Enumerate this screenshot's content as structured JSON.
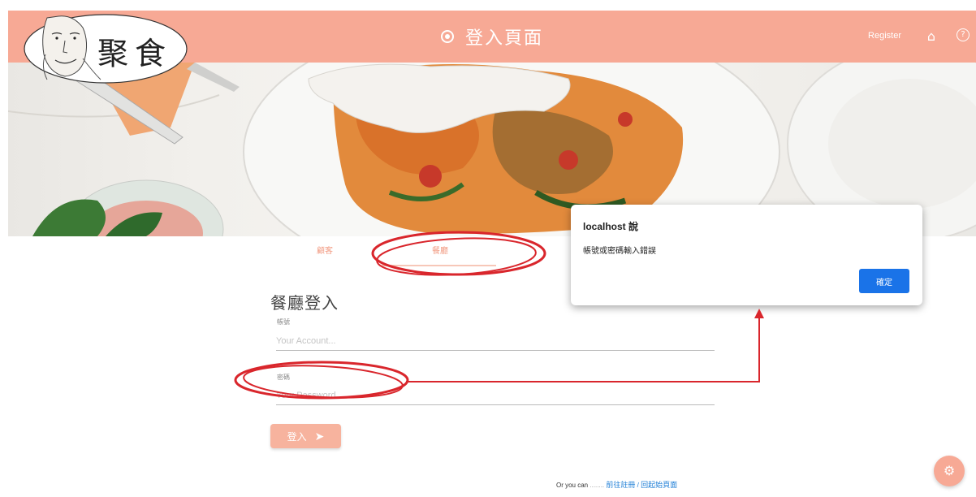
{
  "header": {
    "title": "登入頁面",
    "register_label": "Register",
    "logo_text": "聚食",
    "home_icon": "home-icon",
    "help_icon": "help-icon",
    "background_color": "#f7a995"
  },
  "tabs": [
    {
      "label": "顧客",
      "selected": false
    },
    {
      "label": "餐廳",
      "selected": true
    }
  ],
  "form": {
    "title": "餐廳登入",
    "account_label": "帳號",
    "account_placeholder": "Your Account...",
    "password_label": "密碼",
    "password_placeholder": "Your Password...",
    "submit_label": "登入"
  },
  "footer": {
    "prefix": "Or you can",
    "dots": "........",
    "register_link": "前往註冊",
    "separator": "/",
    "home_link": "回起始頁面"
  },
  "dialog": {
    "title": "localhost 說",
    "message": "帳號或密碼輸入錯誤",
    "ok_label": "確定",
    "ok_color": "#1a73e8"
  },
  "annotation_color": "#d9262c"
}
